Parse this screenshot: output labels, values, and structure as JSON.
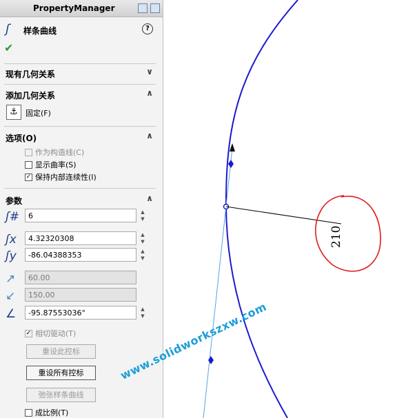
{
  "panel": {
    "title": "PropertyManager",
    "feature_name": "样条曲线",
    "help_glyph": "?",
    "ok_glyph": "✔"
  },
  "sections": {
    "existing_relations": "现有几何关系",
    "add_relations": "添加几何关系",
    "fix_label": "固定(F)",
    "options": "选项(O)",
    "parameters": "参数"
  },
  "options": [
    {
      "label": "作为构造线(C)",
      "checked": false,
      "disabled": true
    },
    {
      "label": "显示曲率(S)",
      "checked": false,
      "disabled": false
    },
    {
      "label": "保持内部连续性(I)",
      "checked": true,
      "disabled": false
    }
  ],
  "params": {
    "point_number": "6",
    "x_coord": "4.32320308",
    "y_coord": "-86.04388353",
    "tangent_weight_1": "60.00",
    "tangent_weight_2": "150.00",
    "tangent_angle": "-95.87553036°"
  },
  "tangent_driving": {
    "label": "相切驱动(T)",
    "checked": true,
    "disabled": true
  },
  "buttons": {
    "reset_handle": "重设此控标",
    "reset_all": "重设所有控标",
    "relax_spline": "弛张样条曲线"
  },
  "proportional": {
    "label": "成比例(T)",
    "checked": false
  },
  "viewport": {
    "dimension_value": "210",
    "watermark": "www.solidworkszxw.com",
    "spline_color": "#1a1ad0",
    "annotation_color": "#e01a1a",
    "handle_color": "#5aa0e6"
  }
}
